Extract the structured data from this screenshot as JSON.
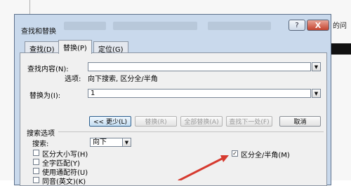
{
  "background": {
    "doc_text": "的问"
  },
  "dialog": {
    "title": "查找和替换",
    "help_label": "?",
    "close_label": "X"
  },
  "tabs": [
    {
      "label": "查找(D)"
    },
    {
      "label": "替换(P)"
    },
    {
      "label": "定位(G)"
    }
  ],
  "find": {
    "label": "查找内容(N):",
    "value": "",
    "options_label": "选项:",
    "options_value": "向下搜索, 区分全/半角"
  },
  "replace": {
    "label": "替换为(I):",
    "value": "1"
  },
  "buttons": {
    "less": "<< 更少(L)",
    "replace": "替换(R)",
    "replace_all": "全部替换(A)",
    "find_next": "查找下一处(F)",
    "cancel": "取消"
  },
  "search_options": {
    "group_label": "搜索选项",
    "search_label": "搜索:",
    "search_value": "向下",
    "checkboxes": [
      {
        "label": "区分大小写(H)",
        "checked": false
      },
      {
        "label": "全字匹配(Y)",
        "checked": false
      },
      {
        "label": "使用通配符(U)",
        "checked": false
      },
      {
        "label": "同音(英文)(K)",
        "checked": false
      },
      {
        "label": "区分全/半角(M)",
        "checked": true
      }
    ]
  },
  "colors": {
    "frame": "#c9d9ec",
    "panel": "#f0f0f0",
    "close": "#c4432e",
    "arrow": "#d63a2f"
  }
}
